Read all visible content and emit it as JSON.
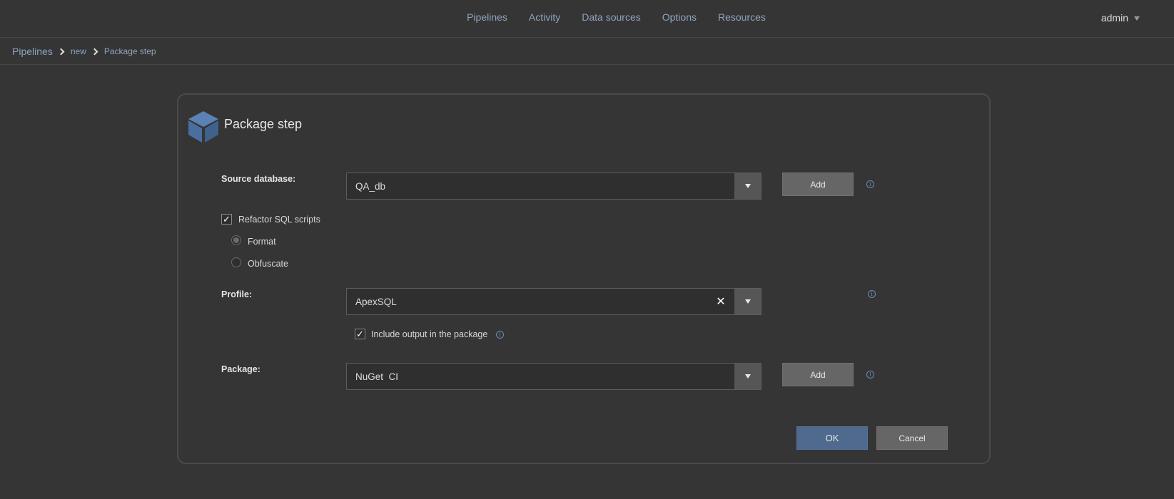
{
  "header": {
    "nav": [
      "Pipelines",
      "Activity",
      "Data sources",
      "Options",
      "Resources"
    ],
    "user": "admin"
  },
  "breadcrumb": {
    "items": [
      "Pipelines",
      "new",
      "Package step"
    ]
  },
  "dialog": {
    "title": "Package step",
    "source_database": {
      "label": "Source database:",
      "value": "QA_db",
      "add_label": "Add"
    },
    "refactor": {
      "label": "Refactor SQL scripts",
      "checked": true,
      "options": [
        "Format",
        "Obfuscate"
      ],
      "selected": "Format"
    },
    "profile": {
      "label": "Profile:",
      "value": "ApexSQL"
    },
    "include_output": {
      "label": "Include output in the package",
      "checked": true
    },
    "package": {
      "label": "Package:",
      "value": "NuGet  CI",
      "add_label": "Add"
    },
    "ok_label": "OK",
    "cancel_label": "Cancel"
  },
  "icons": {
    "cube": "cube-icon",
    "info": "info-icon",
    "dropdown": "chevron-down-icon",
    "clear": "close-icon",
    "breadcrumb_separator": "chevron-right-icon",
    "user_menu": "caret-down-icon"
  },
  "colors": {
    "background": "#353535",
    "link": "#8ea4bd",
    "primary_button": "#4f6a8e",
    "secondary_button": "#666666",
    "cube_icon": "#4a6f9e"
  }
}
